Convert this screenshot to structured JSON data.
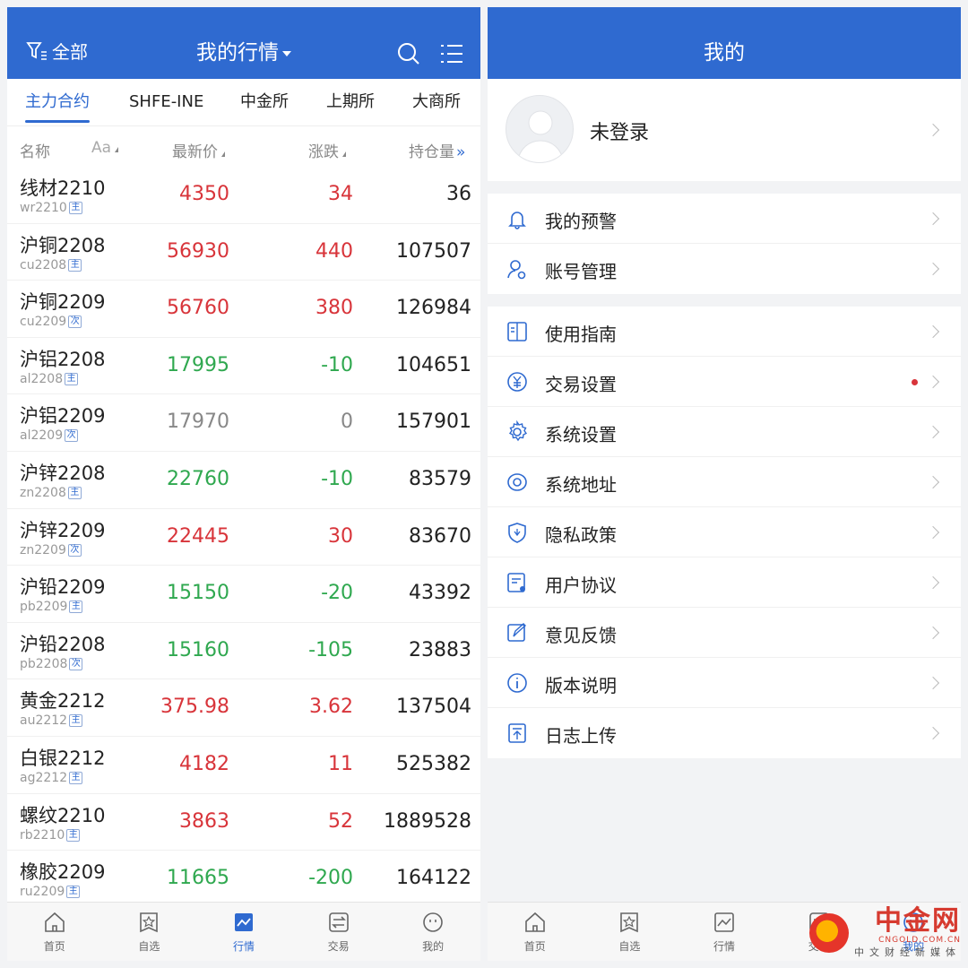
{
  "market": {
    "title": "我的行情",
    "filter_label": "全部",
    "tabs": [
      "主力合约",
      "SHFE-INE",
      "中金所",
      "上期所",
      "大商所"
    ],
    "columns": {
      "name": "名称",
      "font": "Aa",
      "price": "最新价",
      "change": "涨跌",
      "oi": "持仓量"
    },
    "rows": [
      {
        "name": "线材2210",
        "code": "wr2210",
        "tag": "主",
        "price": "4350",
        "change": "34",
        "oi": "36",
        "trend": "up"
      },
      {
        "name": "沪铜2208",
        "code": "cu2208",
        "tag": "主",
        "price": "56930",
        "change": "440",
        "oi": "107507",
        "trend": "up"
      },
      {
        "name": "沪铜2209",
        "code": "cu2209",
        "tag": "次",
        "price": "56760",
        "change": "380",
        "oi": "126984",
        "trend": "up"
      },
      {
        "name": "沪铝2208",
        "code": "al2208",
        "tag": "主",
        "price": "17995",
        "change": "-10",
        "oi": "104651",
        "trend": "down"
      },
      {
        "name": "沪铝2209",
        "code": "al2209",
        "tag": "次",
        "price": "17970",
        "change": "0",
        "oi": "157901",
        "trend": "flat"
      },
      {
        "name": "沪锌2208",
        "code": "zn2208",
        "tag": "主",
        "price": "22760",
        "change": "-10",
        "oi": "83579",
        "trend": "down"
      },
      {
        "name": "沪锌2209",
        "code": "zn2209",
        "tag": "次",
        "price": "22445",
        "change": "30",
        "oi": "83670",
        "trend": "up"
      },
      {
        "name": "沪铅2209",
        "code": "pb2209",
        "tag": "主",
        "price": "15150",
        "change": "-20",
        "oi": "43392",
        "trend": "down"
      },
      {
        "name": "沪铅2208",
        "code": "pb2208",
        "tag": "次",
        "price": "15160",
        "change": "-105",
        "oi": "23883",
        "trend": "down"
      },
      {
        "name": "黄金2212",
        "code": "au2212",
        "tag": "主",
        "price": "375.98",
        "change": "3.62",
        "oi": "137504",
        "trend": "up"
      },
      {
        "name": "白银2212",
        "code": "ag2212",
        "tag": "主",
        "price": "4182",
        "change": "11",
        "oi": "525382",
        "trend": "up"
      },
      {
        "name": "螺纹2210",
        "code": "rb2210",
        "tag": "主",
        "price": "3863",
        "change": "52",
        "oi": "1889528",
        "trend": "up"
      },
      {
        "name": "橡胶2209",
        "code": "ru2209",
        "tag": "主",
        "price": "11665",
        "change": "-200",
        "oi": "164122",
        "trend": "down"
      }
    ]
  },
  "nav": [
    "首页",
    "自选",
    "行情",
    "交易",
    "我的"
  ],
  "mine": {
    "title": "我的",
    "login_label": "未登录",
    "group1": [
      "我的预警",
      "账号管理"
    ],
    "group2": [
      "使用指南",
      "交易设置",
      "系统设置",
      "系统地址",
      "隐私政策",
      "用户协议",
      "意见反馈",
      "版本说明",
      "日志上传"
    ]
  },
  "watermark": {
    "name": "中金网",
    "url": "CNGOLD.COM.CN",
    "sub": "中文财经新媒体"
  },
  "colors": {
    "brand": "#2f6ad0",
    "up": "#d8343a",
    "down": "#2fa84f"
  }
}
